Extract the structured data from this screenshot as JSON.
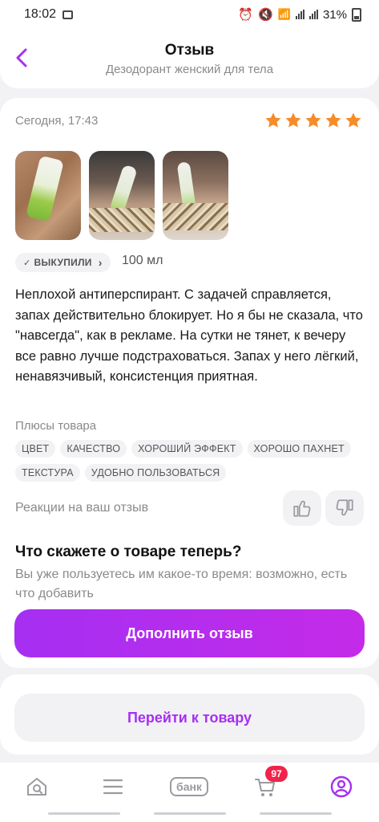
{
  "status_bar": {
    "time": "18:02",
    "battery": "31%"
  },
  "header": {
    "title": "Отзыв",
    "subtitle": "Дезодорант женский для тела"
  },
  "review": {
    "date": "Сегодня, 17:43",
    "rating": 5,
    "bought_label": "ВЫКУПИЛИ",
    "size": "100 мл",
    "text": "Неплохой антиперспирант. С задачей справляется, запах действительно блокирует. Но я бы не сказала, что \"навсегда\", как в рекламе. На сутки не тянет, к вечеру все равно лучше подстраховаться. Запах у него лёгкий, ненавязчивый, консистенция приятная.",
    "pros_label": "Плюсы товара",
    "tags": [
      "ЦВЕТ",
      "КАЧЕСТВО",
      "ХОРОШИЙ ЭФФЕКТ",
      "ХОРОШО ПАХНЕТ",
      "ТЕКСТУРА",
      "УДОБНО ПОЛЬЗОВАТЬСЯ"
    ],
    "reactions_label": "Реакции на ваш отзыв"
  },
  "prompt": {
    "title": "Что скажете о товаре теперь?",
    "subtitle": "Вы уже пользуетесь им какое-то время: возможно, есть что добавить"
  },
  "buttons": {
    "add_review": "Дополнить отзыв",
    "go_to_product": "Перейти к товару"
  },
  "tabbar": {
    "bank_label": "банк",
    "cart_badge": "97"
  },
  "colors": {
    "accent": "#a52ff2",
    "star": "#f68b28",
    "badge": "#f0244a"
  }
}
